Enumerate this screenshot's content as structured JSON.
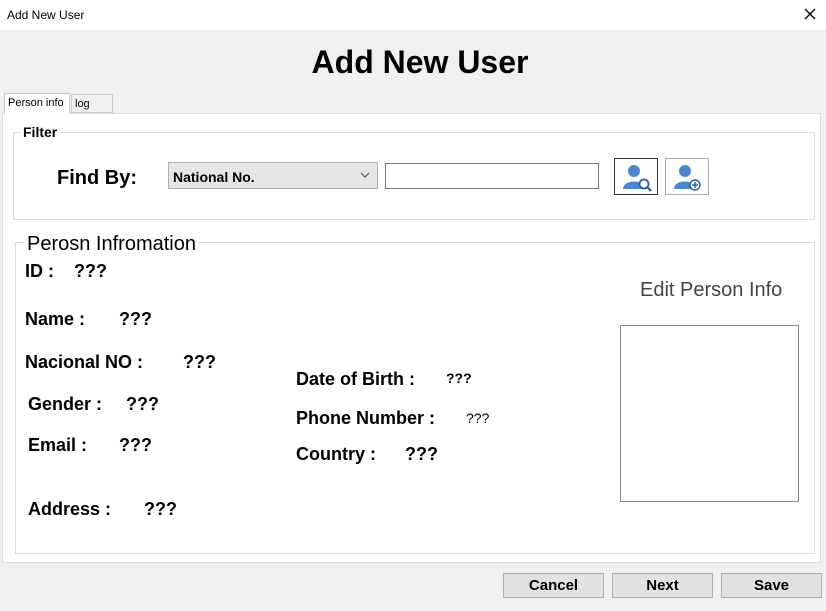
{
  "window": {
    "title": "Add New User"
  },
  "header": {
    "title": "Add New User"
  },
  "tabs": [
    {
      "label": "Person info",
      "active": true
    },
    {
      "label": "log info",
      "active": false
    }
  ],
  "filter": {
    "group_label": "Filter",
    "find_by_label": "Find By:",
    "find_by_selected": "National No.",
    "search_value": ""
  },
  "person": {
    "group_label": "Perosn Infromation",
    "id_label": "ID :",
    "id_value": "???",
    "name_label": "Name :",
    "name_value": "???",
    "national_label": "Nacional NO :",
    "national_value": "???",
    "gender_label": "Gender :",
    "gender_value": "???",
    "email_label": "Email :",
    "email_value": "???",
    "address_label": "Address :",
    "address_value": "???",
    "dob_label": "Date of Birth :",
    "dob_value": "???",
    "phone_label": "Phone Number :",
    "phone_value": "???",
    "country_label": "Country :",
    "country_value": "???",
    "edit_link": "Edit Person Info"
  },
  "footer": {
    "cancel_label": "Cancel",
    "next_label": "Next",
    "save_label": "Save"
  },
  "icons": {
    "close": "close-icon",
    "find": "user-search-icon",
    "add": "user-add-icon",
    "dropdown": "chevron-down-icon"
  },
  "colors": {
    "user_icon": "#4a86c8",
    "panel_border": "#dcdcdc"
  }
}
